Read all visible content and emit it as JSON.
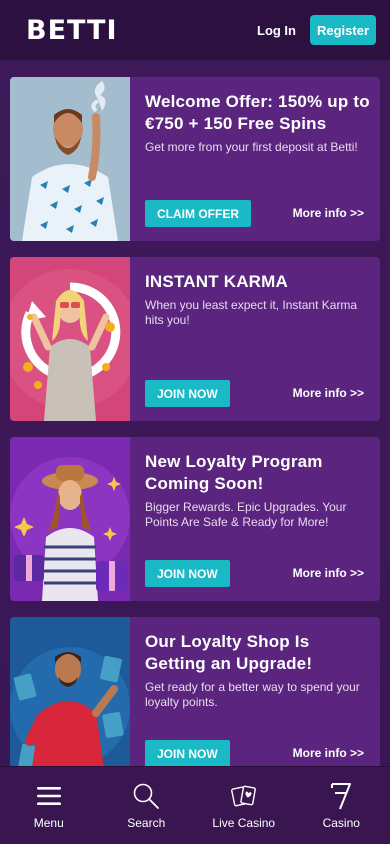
{
  "header": {
    "logo": "BETTI",
    "login_label": "Log In",
    "register_label": "Register",
    "accent_color": "#1ab9c6"
  },
  "promotions": [
    {
      "title": "Welcome Offer: 150% up to €750 + 150 Free Spins",
      "description": "Get more from your first deposit at Betti!",
      "cta": "CLAIM OFFER",
      "more": "More info >>",
      "image": "bearded-man-smoke"
    },
    {
      "title": "INSTANT KARMA",
      "description": "When you least expect it, Instant Karma hits you!",
      "cta": "JOIN NOW",
      "more": "More info >>",
      "image": "woman-with-coins"
    },
    {
      "title": "New Loyalty Program Coming Soon!",
      "description": "Bigger Rewards. Epic Upgrades. Your Points Are Safe & Ready for More!",
      "cta": "JOIN NOW",
      "more": "More info >>",
      "image": "woman-with-gifts"
    },
    {
      "title": "Our Loyalty Shop Is Getting an Upgrade!",
      "description": "Get ready for a better way to spend your loyalty points.",
      "cta": "JOIN NOW",
      "more": "More info >>",
      "image": "man-with-cards"
    }
  ],
  "bottom_nav": [
    {
      "label": "Menu",
      "icon": "hamburger-icon"
    },
    {
      "label": "Search",
      "icon": "search-icon"
    },
    {
      "label": "Live Casino",
      "icon": "cards-icon"
    },
    {
      "label": "Casino",
      "icon": "seven-icon"
    }
  ]
}
